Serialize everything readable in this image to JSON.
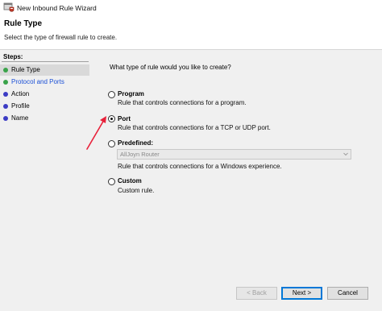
{
  "window": {
    "title": "New Inbound Rule Wizard",
    "icon": "firewall-shield-icon"
  },
  "header": {
    "title": "Rule Type",
    "subtitle": "Select the type of firewall rule to create."
  },
  "steps": {
    "title": "Steps:",
    "items": [
      {
        "label": "Rule Type",
        "state": "current",
        "color": "#3aa34a"
      },
      {
        "label": "Protocol and Ports",
        "state": "link",
        "color": "#3aa34a"
      },
      {
        "label": "Action",
        "state": "normal",
        "color": "#3b3bc4"
      },
      {
        "label": "Profile",
        "state": "normal",
        "color": "#3b3bc4"
      },
      {
        "label": "Name",
        "state": "normal",
        "color": "#3b3bc4"
      }
    ]
  },
  "main": {
    "question": "What type of rule would you like to create?",
    "options": [
      {
        "label": "Program",
        "description": "Rule that controls connections for a program.",
        "selected": false
      },
      {
        "label": "Port",
        "description": "Rule that controls connections for a TCP or UDP port.",
        "selected": true
      },
      {
        "label": "Predefined:",
        "description": "Rule that controls connections for a Windows experience.",
        "selected": false
      },
      {
        "label": "Custom",
        "description": "Custom rule.",
        "selected": false
      }
    ],
    "predefined_select": {
      "value": "AllJoyn Router",
      "disabled": true
    }
  },
  "buttons": {
    "back": "< Back",
    "next": "Next >",
    "cancel": "Cancel"
  },
  "annotation": {
    "arrow_color": "#e8213a"
  }
}
